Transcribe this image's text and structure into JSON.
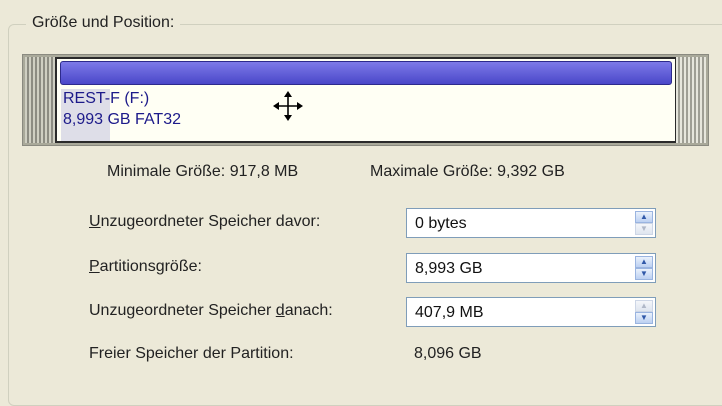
{
  "group": {
    "title": "Größe und Position:"
  },
  "partition": {
    "label_line1": "REST-F (F:)",
    "label_line2": "8,993 GB  FAT32",
    "used_fraction": 0.08
  },
  "limits": {
    "min_label": "Minimale Größe: 917,8 MB",
    "max_label": "Maximale Größe: 9,392 GB"
  },
  "fields": [
    {
      "label_before": "",
      "accel": "U",
      "label_after": "nzugeordneter Speicher davor:",
      "value": "0 bytes",
      "up_enabled": true,
      "down_enabled": false
    },
    {
      "label_before": "",
      "accel": "P",
      "label_after": "artitionsgröße:",
      "value": "8,993 GB",
      "up_enabled": true,
      "down_enabled": true
    },
    {
      "label_before": "Unzugeordneter Speicher ",
      "accel": "d",
      "label_after": "anach:",
      "value": "407,9 MB",
      "up_enabled": false,
      "down_enabled": true
    }
  ],
  "free": {
    "label": "Freier Speicher der Partition:",
    "value": "8,096 GB"
  },
  "icons": {
    "move": "move-arrows-icon",
    "spin_up": "up-arrow-icon",
    "spin_down": "down-arrow-icon"
  }
}
